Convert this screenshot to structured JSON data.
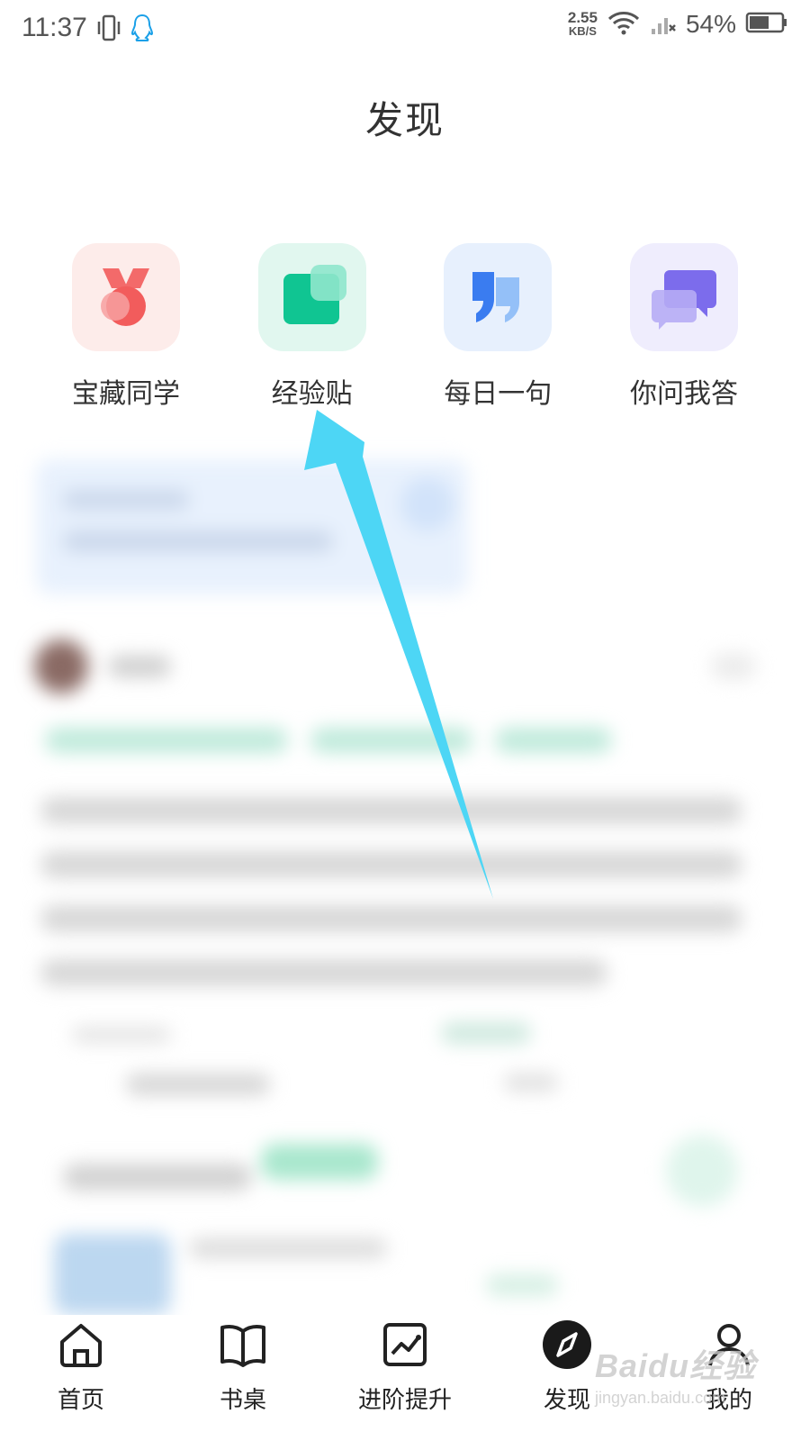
{
  "status_bar": {
    "time": "11:37",
    "net_speed_value": "2.55",
    "net_speed_unit": "KB/S",
    "battery": "54%",
    "icons": [
      "vibrate-icon",
      "qq-icon",
      "wifi-icon",
      "signal-icon",
      "battery-icon"
    ]
  },
  "page": {
    "title": "发现"
  },
  "features": [
    {
      "label": "宝藏同学",
      "icon": "medal-icon",
      "accent": "#f25c5c"
    },
    {
      "label": "经验贴",
      "icon": "experience-icon",
      "accent": "#1ec99b"
    },
    {
      "label": "每日一句",
      "icon": "quote-icon",
      "accent": "#3a7cf0"
    },
    {
      "label": "你问我答",
      "icon": "chat-bubbles-icon",
      "accent": "#8474ee"
    }
  ],
  "annotation": {
    "arrow_color": "#4dd6f5"
  },
  "bottom_nav": [
    {
      "label": "首页",
      "icon": "home-icon"
    },
    {
      "label": "书桌",
      "icon": "book-icon"
    },
    {
      "label": "进阶提升",
      "icon": "growth-chart-icon"
    },
    {
      "label": "发现",
      "icon": "compass-icon",
      "active": true
    },
    {
      "label": "我的",
      "icon": "profile-icon"
    }
  ],
  "watermark": {
    "main": "Baidu经验",
    "sub": "jingyan.baidu.com"
  }
}
